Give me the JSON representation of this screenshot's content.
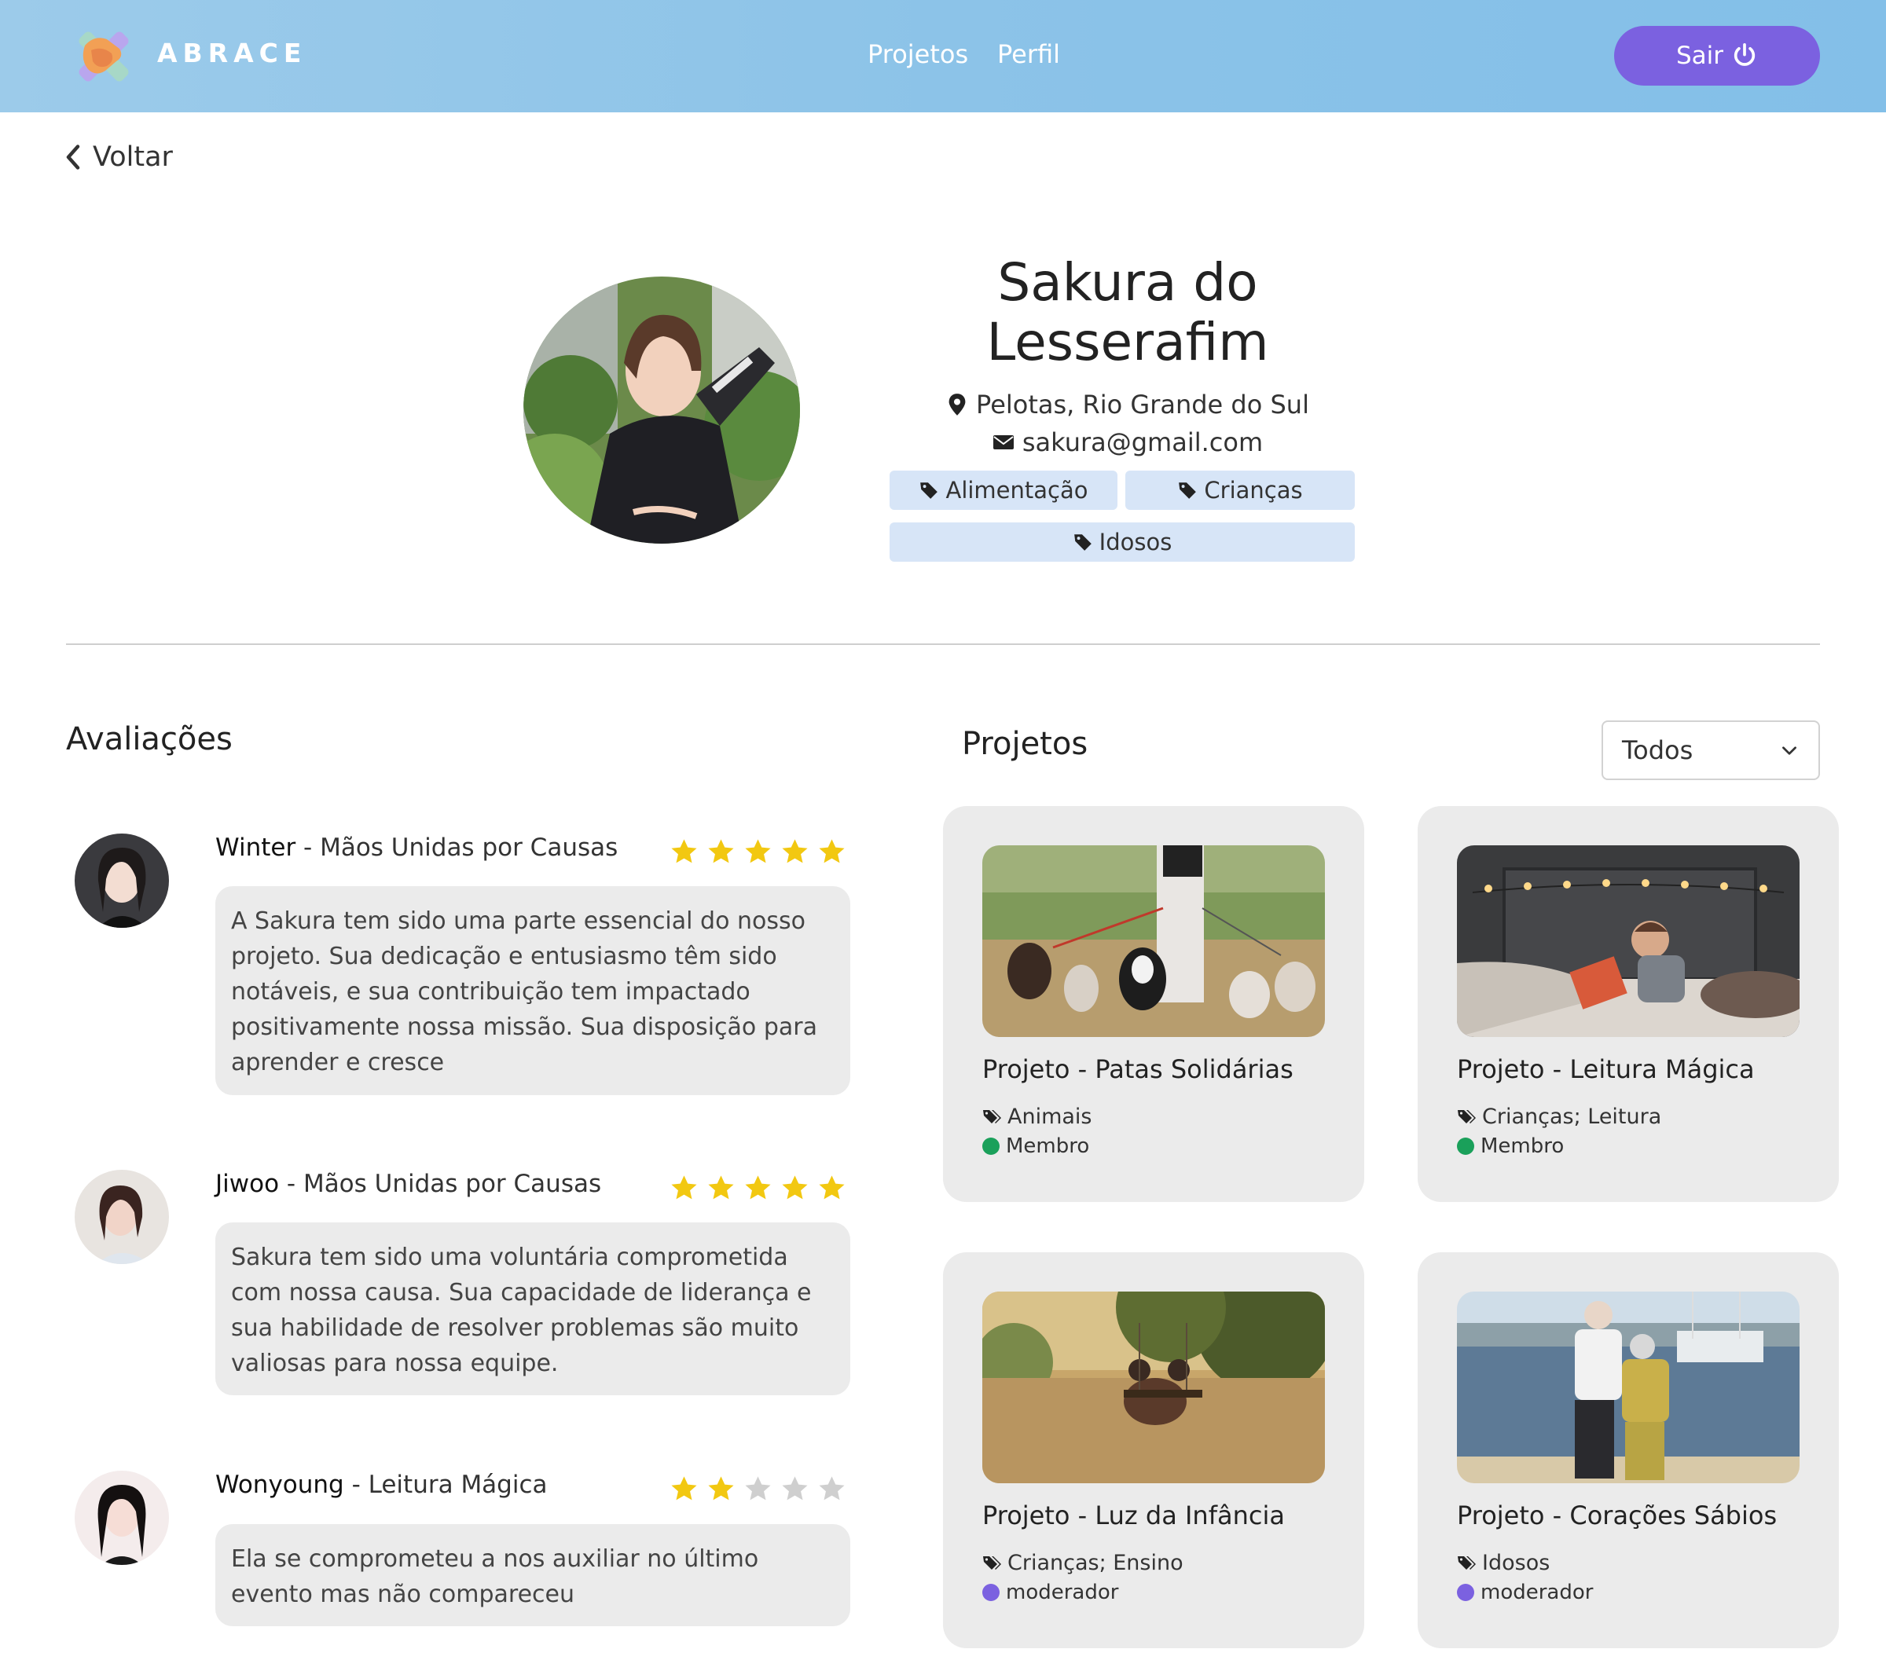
{
  "header": {
    "brand": "ABRACE",
    "nav": [
      "Projetos",
      "Perfil"
    ],
    "logout_label": "Sair"
  },
  "back_label": "Voltar",
  "profile": {
    "name": "Sakura do Lesserafim",
    "location": "Pelotas, Rio Grande do Sul",
    "email": "sakura@gmail.com",
    "tags": [
      "Alimentação",
      "Crianças",
      "Idosos"
    ]
  },
  "reviews": {
    "title": "Avaliações",
    "items": [
      {
        "author": "Winter",
        "project": " - Mãos Unidas por Causas",
        "rating": 5,
        "text": "A Sakura tem sido uma parte essencial do nosso projeto. Sua dedicação e entusiasmo têm sido notáveis, e sua contribuição tem impactado positivamente nossa missão. Sua disposição para aprender e cresce"
      },
      {
        "author": "Jiwoo",
        "project": " - Mãos Unidas por Causas",
        "rating": 5,
        "text": "Sakura tem sido uma voluntária comprometida com nossa causa. Sua capacidade de liderança e sua habilidade de resolver problemas são muito valiosas para nossa equipe."
      },
      {
        "author": "Wonyoung",
        "project": " - Leitura Mágica",
        "rating": 2,
        "text": "Ela se comprometeu a nos auxiliar no último evento mas não compareceu"
      }
    ]
  },
  "projects": {
    "title": "Projetos",
    "filter_value": "Todos",
    "items": [
      {
        "title": "Projeto - Patas Solidárias",
        "tags": "Animais",
        "role": "Membro",
        "role_color": "#1aa05a"
      },
      {
        "title": "Projeto - Leitura Mágica",
        "tags": "Crianças; Leitura",
        "role": "Membro",
        "role_color": "#1aa05a"
      },
      {
        "title": "Projeto - Luz da Infância",
        "tags": "Crianças; Ensino",
        "role": "moderador",
        "role_color": "#7b61e0"
      },
      {
        "title": "Projeto - Corações Sábios",
        "tags": "Idosos",
        "role": "moderador",
        "role_color": "#7b61e0"
      }
    ]
  },
  "colors": {
    "accent": "#7b61e0",
    "star_filled": "#f2c811",
    "star_empty": "#cfcfcf",
    "tag_bg": "#d7e5f7"
  }
}
